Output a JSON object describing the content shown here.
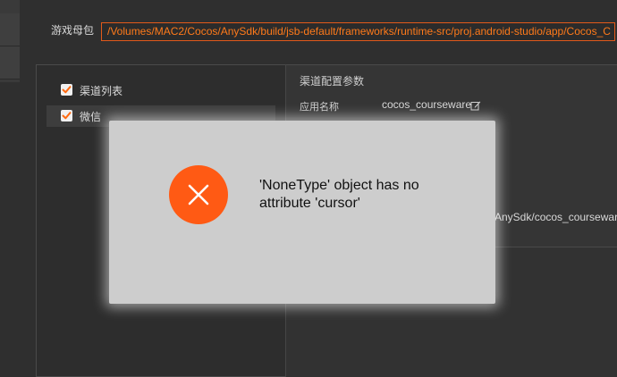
{
  "header": {
    "game_package_label": "游戏母包",
    "game_package_path": "/Volumes/MAC2/Cocos/AnySdk/build/jsb-default/frameworks/runtime-src/proj.android-studio/app/Cocos_C"
  },
  "channel_tree": {
    "items": [
      {
        "label": "渠道列表",
        "checked": true
      },
      {
        "label": "微信",
        "checked": true
      }
    ]
  },
  "config": {
    "title": "渠道配置参数",
    "app_name_label": "应用名称",
    "app_name_value": "cocos_courseware",
    "output_path_fragment": "AnySdk/cocos_courseware"
  },
  "error_dialog": {
    "message": "'NoneType' object has no attribute 'cursor'",
    "icon": "close-icon",
    "accent": "#ff5a14"
  }
}
